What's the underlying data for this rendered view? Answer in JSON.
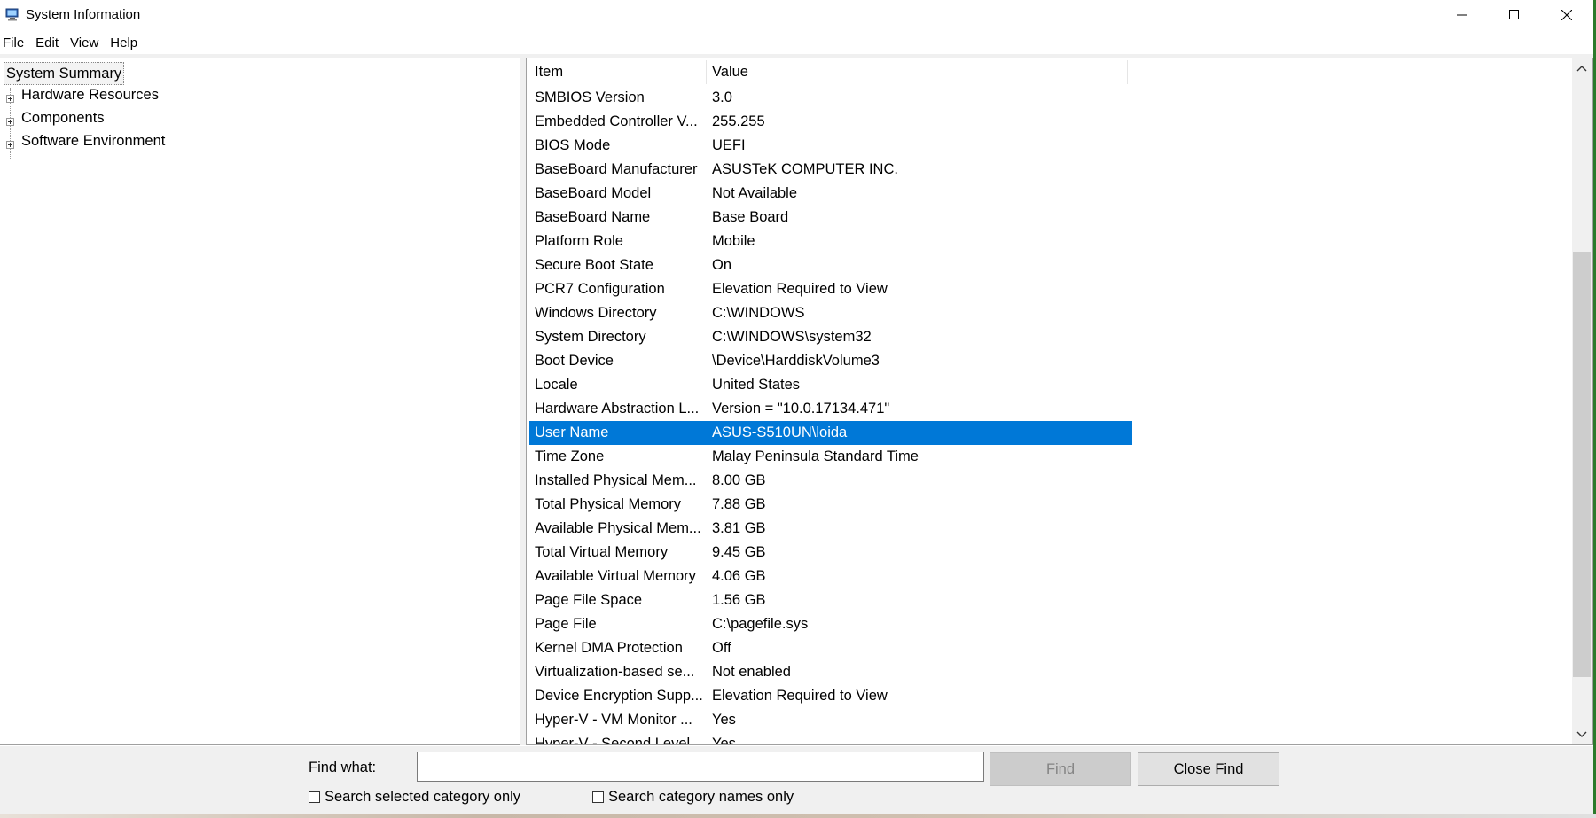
{
  "window": {
    "title": "System Information",
    "controls": {
      "minimize": "minimize",
      "maximize": "maximize",
      "close": "close"
    }
  },
  "menu": [
    "File",
    "Edit",
    "View",
    "Help"
  ],
  "tree": {
    "root": "System Summary",
    "children": [
      "Hardware Resources",
      "Components",
      "Software Environment"
    ]
  },
  "list": {
    "headers": {
      "item": "Item",
      "value": "Value"
    },
    "rows": [
      {
        "item": "SMBIOS Version",
        "value": "3.0"
      },
      {
        "item": "Embedded Controller V...",
        "value": "255.255"
      },
      {
        "item": "BIOS Mode",
        "value": "UEFI"
      },
      {
        "item": "BaseBoard Manufacturer",
        "value": "ASUSTeK COMPUTER INC."
      },
      {
        "item": "BaseBoard Model",
        "value": "Not Available"
      },
      {
        "item": "BaseBoard Name",
        "value": "Base Board"
      },
      {
        "item": "Platform Role",
        "value": "Mobile"
      },
      {
        "item": "Secure Boot State",
        "value": "On"
      },
      {
        "item": "PCR7 Configuration",
        "value": "Elevation Required to View"
      },
      {
        "item": "Windows Directory",
        "value": "C:\\WINDOWS"
      },
      {
        "item": "System Directory",
        "value": "C:\\WINDOWS\\system32"
      },
      {
        "item": "Boot Device",
        "value": "\\Device\\HarddiskVolume3"
      },
      {
        "item": "Locale",
        "value": "United States"
      },
      {
        "item": "Hardware Abstraction L...",
        "value": "Version = \"10.0.17134.471\""
      },
      {
        "item": "User Name",
        "value": "ASUS-S510UN\\loida",
        "selected": true
      },
      {
        "item": "Time Zone",
        "value": "Malay Peninsula Standard Time"
      },
      {
        "item": "Installed Physical Mem...",
        "value": "8.00 GB"
      },
      {
        "item": "Total Physical Memory",
        "value": "7.88 GB"
      },
      {
        "item": "Available Physical Mem...",
        "value": "3.81 GB"
      },
      {
        "item": "Total Virtual Memory",
        "value": "9.45 GB"
      },
      {
        "item": "Available Virtual Memory",
        "value": "4.06 GB"
      },
      {
        "item": "Page File Space",
        "value": "1.56 GB"
      },
      {
        "item": "Page File",
        "value": "C:\\pagefile.sys"
      },
      {
        "item": "Kernel DMA Protection",
        "value": "Off"
      },
      {
        "item": "Virtualization-based se...",
        "value": "Not enabled"
      },
      {
        "item": "Device Encryption Supp...",
        "value": "Elevation Required to View"
      },
      {
        "item": "Hyper-V - VM Monitor ...",
        "value": "Yes"
      },
      {
        "item": "Hyper-V - Second Level ...",
        "value": "Yes"
      }
    ]
  },
  "find": {
    "label": "Find what:",
    "value": "",
    "find_button": "Find",
    "close_button": "Close Find",
    "checkbox_selected_category": "Search selected category only",
    "checkbox_category_names": "Search category names only"
  },
  "colors": {
    "selection": "#0078d7",
    "chrome": "#f0f0f0"
  }
}
